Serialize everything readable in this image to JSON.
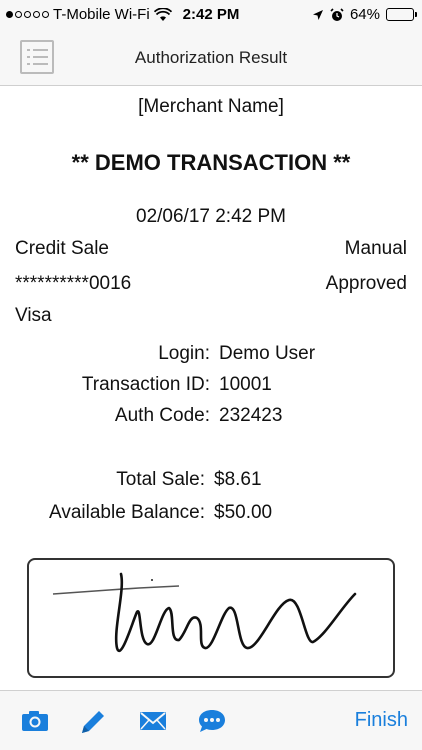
{
  "status_bar": {
    "carrier": "T-Mobile Wi-Fi",
    "time": "2:42 PM",
    "battery": "64%",
    "battery_level": 0.64
  },
  "nav": {
    "title": "Authorization Result",
    "menu_icon": "list-icon"
  },
  "receipt": {
    "merchant": "[Merchant Name]",
    "banner": "** DEMO TRANSACTION **",
    "datetime": "02/06/17 2:42 PM",
    "type": "Credit Sale",
    "entry": "Manual",
    "card_number": "**********0016",
    "status": "Approved",
    "card_brand": "Visa",
    "login_label": "Login:",
    "login_value": "Demo User",
    "txn_label": "Transaction ID:",
    "txn_value": "10001",
    "auth_label": "Auth Code:",
    "auth_value": "232423",
    "total_label": "Total Sale:",
    "total_value": "$8.61",
    "balance_label": "Available Balance:",
    "balance_value": "$50.00"
  },
  "toolbar": {
    "icons": [
      "camera-icon",
      "pencil-icon",
      "mail-icon",
      "chat-icon"
    ],
    "finish_label": "Finish",
    "accent": "#1a7fdc"
  }
}
